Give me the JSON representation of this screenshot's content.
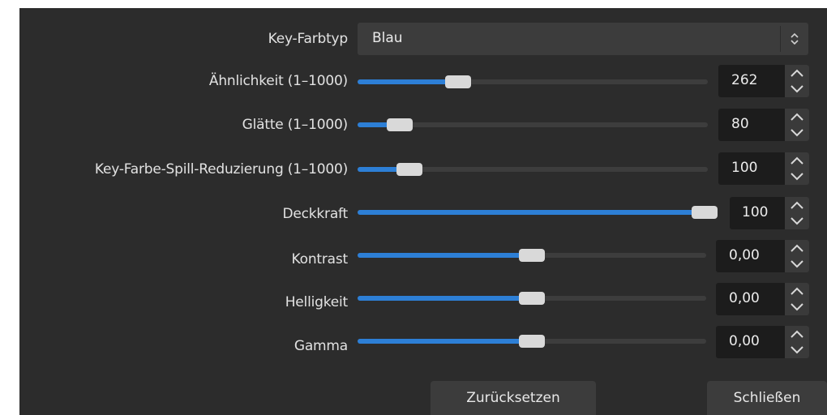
{
  "form": {
    "key_color_type": {
      "label": "Key-Farbtyp",
      "value": "Blau"
    },
    "similarity": {
      "label": "Ähnlichkeit (1–1000)",
      "value": "262",
      "fraction": 0.27
    },
    "smoothness": {
      "label": "Glätte (1–1000)",
      "value": "80",
      "fraction": 0.09
    },
    "spill_reduction": {
      "label": "Key-Farbe-Spill-Reduzierung (1–1000)",
      "value": "100",
      "fraction": 0.12
    },
    "opacity": {
      "label": "Deckkraft",
      "value": "100",
      "fraction": 1.0
    },
    "contrast": {
      "label": "Kontrast",
      "value": "0,00",
      "fraction": 0.5
    },
    "brightness": {
      "label": "Helligkeit",
      "value": "0,00",
      "fraction": 0.5
    },
    "gamma": {
      "label": "Gamma",
      "value": "0,00",
      "fraction": 0.5
    }
  },
  "buttons": {
    "reset_label": "Zurücksetzen",
    "close_label": "Schließen"
  },
  "colors": {
    "accent": "#2d7fd6",
    "panel_bg": "#2c2c2c",
    "field_bg": "#1c1c1c"
  },
  "icons": {
    "dropdown": "updown-chevron-icon",
    "spin_up": "chevron-up-icon",
    "spin_down": "chevron-down-icon"
  }
}
